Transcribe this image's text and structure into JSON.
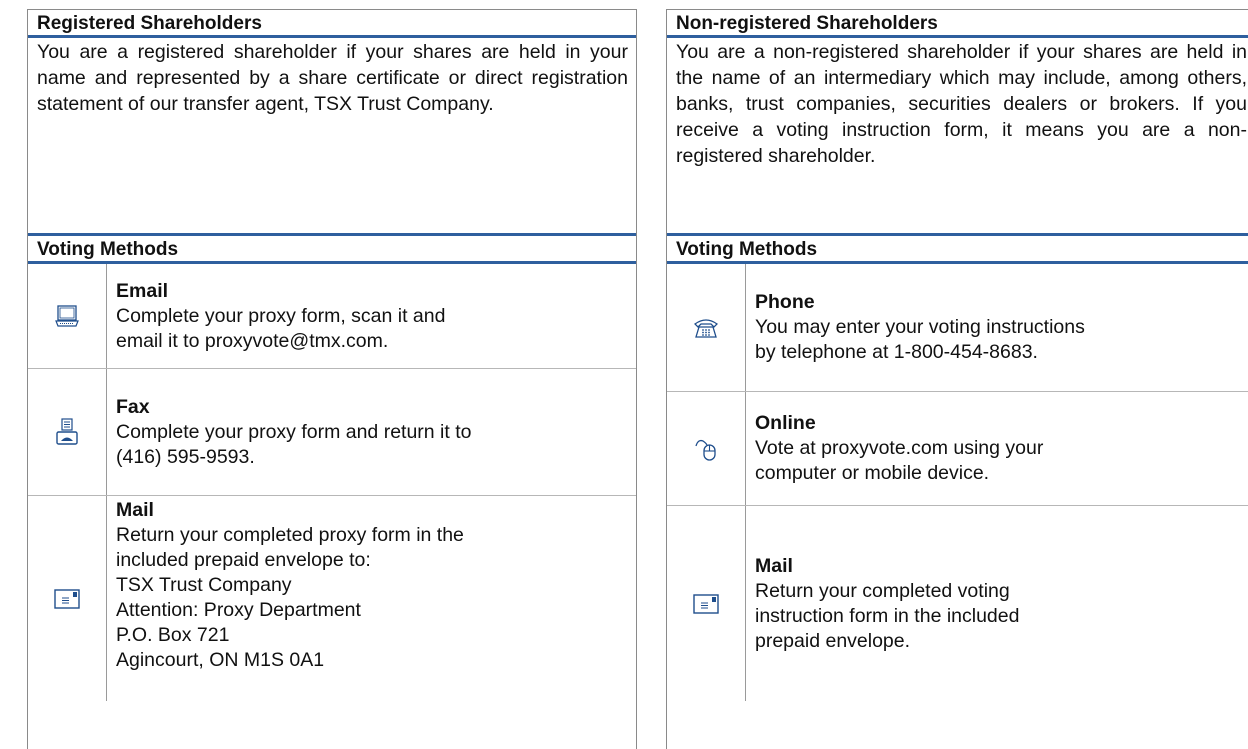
{
  "left": {
    "title": "Registered Shareholders",
    "description": "You are a registered shareholder if your shares are held in your name and represented by a share certificate or direct registration statement of our transfer agent, TSX Trust Company.",
    "methods_title": "Voting Methods",
    "methods": [
      {
        "icon": "computer-icon",
        "title": "Email",
        "lines": [
          "Complete your proxy form, scan it and",
          "email it to proxyvote@tmx.com."
        ]
      },
      {
        "icon": "fax-icon",
        "title": "Fax",
        "lines": [
          "Complete your proxy form and return it to",
          "(416) 595-9593."
        ]
      },
      {
        "icon": "envelope-icon",
        "title": "Mail",
        "lines": [
          "Return your completed proxy form in the",
          "included prepaid envelope to:",
          "TSX Trust Company",
          "Attention: Proxy Department",
          "P.O. Box 721",
          "Agincourt, ON M1S 0A1"
        ]
      }
    ]
  },
  "right": {
    "title": "Non-registered Shareholders",
    "description": "You are a non-registered shareholder if your shares are held in the name of an intermediary which may include, among others, banks, trust companies, securities dealers or brokers.  If you receive a voting instruction form, it means you are a non-registered shareholder.",
    "methods_title": "Voting Methods",
    "methods": [
      {
        "icon": "telephone-icon",
        "title": "Phone",
        "lines": [
          "You may enter your voting instructions",
          "by telephone at 1-800-454-8683."
        ]
      },
      {
        "icon": "mouse-icon",
        "title": "Online",
        "lines": [
          "Vote at proxyvote.com using your",
          "computer or mobile device."
        ]
      },
      {
        "icon": "envelope-icon",
        "title": "Mail",
        "lines": [
          "Return your completed voting",
          "instruction form in the included",
          "prepaid envelope."
        ]
      }
    ]
  },
  "colors": {
    "accent": "#2e5f9e",
    "rule": "#8a8a8a",
    "icon": "#1f4e8c"
  }
}
